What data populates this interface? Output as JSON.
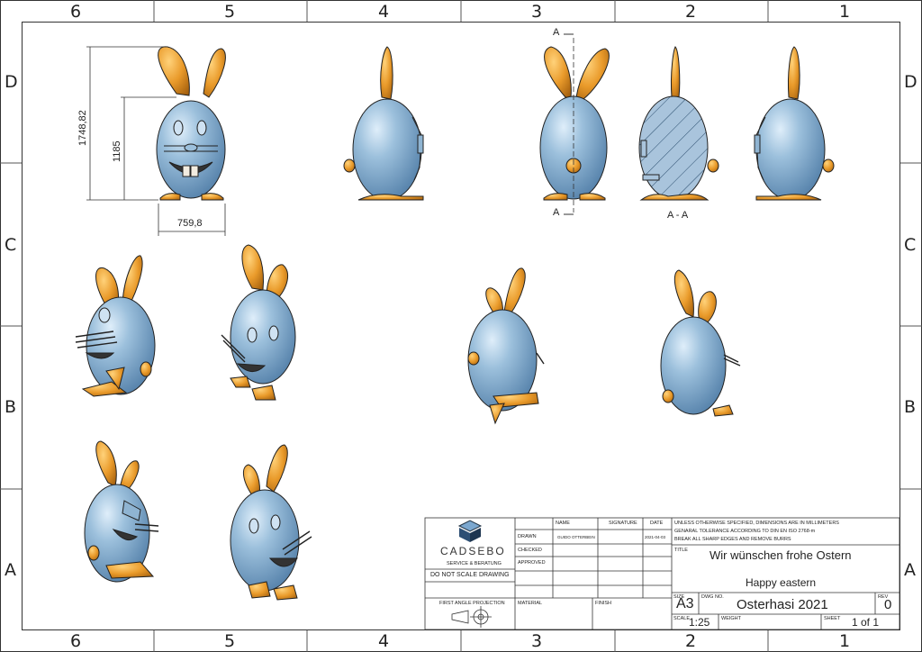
{
  "zones": {
    "columns": [
      "6",
      "5",
      "4",
      "3",
      "2",
      "1"
    ],
    "rows": [
      "D",
      "C",
      "B",
      "A"
    ]
  },
  "dimensions": {
    "total_height": "1748,82",
    "body_height": "1185",
    "width": "759,8"
  },
  "section": {
    "marker": "A",
    "label": "A - A"
  },
  "title_block": {
    "logo_main": "CADSEBO",
    "logo_sub": "SERVICE & BERATUNG",
    "do_not_scale": "DO NOT SCALE DRAWING",
    "projection": "FIRST ANGLE PROJECTION",
    "headers": {
      "name": "NAME",
      "signature": "SIGNATURE",
      "date": "DATE"
    },
    "rows": {
      "drawn": "DRAWN",
      "checked": "CHECKED",
      "approved": "APPROVED",
      "drawn_name": "GUIDO OTTERBEIN",
      "drawn_date": "2021-04-03"
    },
    "material": "MATERIAL",
    "finish": "FINISH",
    "notes": [
      "UNLESS OTHERWISE SPECIFIED, DIMENSIONS ARE IN MILLIMETERS",
      "GENARAL TOLERANCE ACCORDING TO DIN EN ISO 2768-m",
      "BREAK ALL SHARP EDGES AND REMOVE BURRS"
    ],
    "title_label": "TITLE",
    "title_line1": "Wir wünschen frohe Ostern",
    "title_line2": "Happy eastern",
    "size_label": "SIZE",
    "size": "A3",
    "dwg_label": "DWG NO.",
    "dwg_no": "Osterhasi 2021",
    "rev_label": "REV",
    "rev": "0",
    "scale_label": "SCALE",
    "scale": "1:25",
    "weight_label": "WEIGHT",
    "sheet_label": "SHEET",
    "sheet": "1 of 1"
  },
  "colors": {
    "body": "#8fb4d2",
    "body_dark": "#5b86ad",
    "ears": "#e39a2c",
    "ears_dark": "#a8620f",
    "teeth": "#f2ece0",
    "line": "#222222"
  }
}
